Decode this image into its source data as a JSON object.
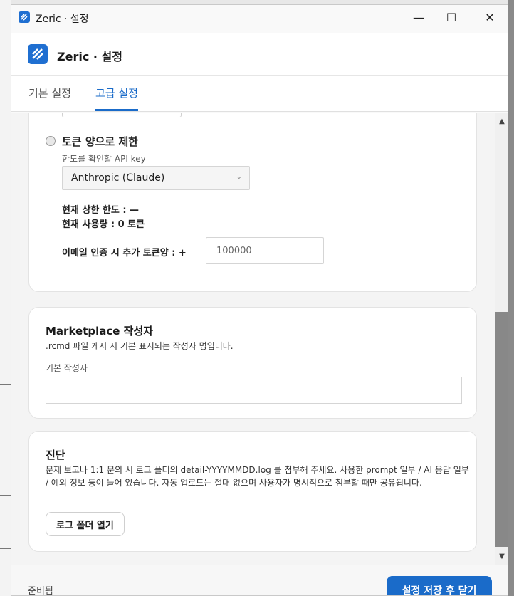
{
  "window": {
    "title": "Zeric · 설정",
    "minimize_icon": "—",
    "maximize_icon": "☐",
    "close_icon": "✕"
  },
  "header": {
    "title": "Zeric · 설정"
  },
  "tabs": [
    {
      "label": "기본 설정",
      "active": false
    },
    {
      "label": "고급 설정",
      "active": true
    }
  ],
  "token_limit": {
    "radio_label": "토큰 양으로 제한",
    "api_key_label": "한도를 확인할 API key",
    "api_key_selected": "Anthropic (Claude)",
    "current_limit": "현재 상한 한도 : —",
    "current_usage": "현재 사용량 : 0 토큰",
    "email_bonus_label": "이메일 인증 시 추가 토큰양 : +",
    "email_bonus_value": "100000"
  },
  "marketplace": {
    "title": "Marketplace 작성자",
    "description": ".rcmd 파일 게시 시 기본 표시되는 작성자 명입니다.",
    "author_label": "기본 작성자",
    "author_value": ""
  },
  "diagnostics": {
    "title": "진단",
    "description": "문제 보고나 1:1 문의 시 로그 폴더의 detail-YYYYMMDD.log 를 첨부해 주세요. 사용한 prompt 일부 / AI 응답 일부 / 예외 정보 등이 들어 있습니다. 자동 업로드는 절대 없으며 사용자가 명시적으로 첨부할 때만 공유됩니다.",
    "open_folder_label": "로그 폴더 열기"
  },
  "footer": {
    "status": "준비됨",
    "save_close_label": "설정 저장 후 닫기"
  },
  "colors": {
    "accent": "#1a6bc9"
  }
}
